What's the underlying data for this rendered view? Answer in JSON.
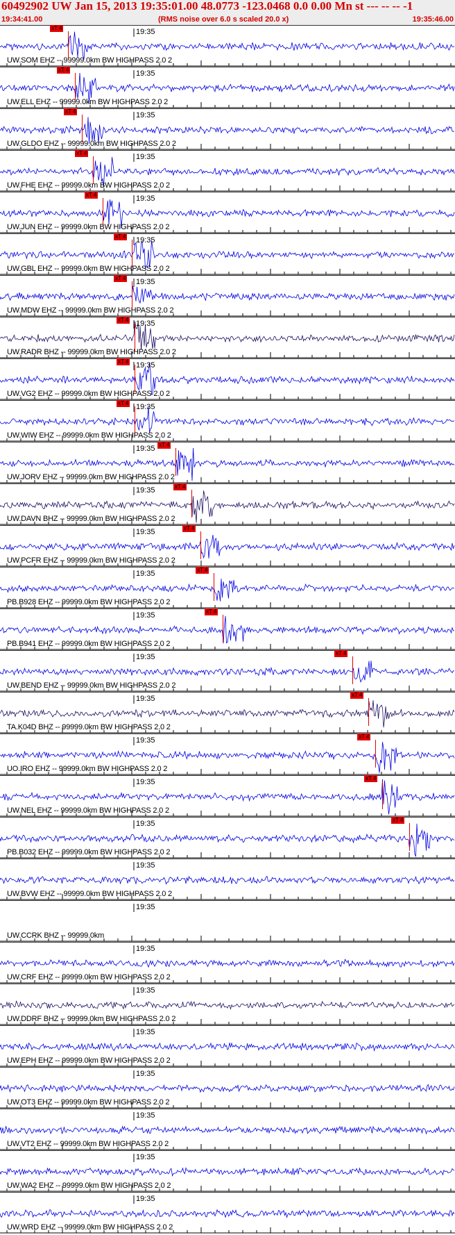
{
  "header": {
    "title": "60492902 UW Jan 15, 2013 19:35:01.00   48.0773 -123.0468  0.0 0.00 Mn st --- -- --   -1",
    "start_time": "19:34:41.00",
    "rms_note": "(RMS noise over 6.0 s scaled 20.0 x)",
    "end_time": "19:35:46.00"
  },
  "time_mark_label": "19:35",
  "pick_label": "xT 4",
  "colors": {
    "trace": "#0000e0",
    "trace_dark": "#1a1060",
    "pick": "#e00000",
    "title": "#d40000"
  },
  "traces": [
    {
      "label": "UW.SOM EHZ -- 99999.0km BW  HIGHPASS  2.0  2",
      "pick": 0.15
    },
    {
      "label": "UW.ELL EHZ -- 99999.0km BW  HIGHPASS  2.0  2",
      "pick": 0.165
    },
    {
      "label": "UW.GLDO EHZ -- 99999.0km BW  HIGHPASS  2.0  2",
      "pick": 0.18
    },
    {
      "label": "UW.FHE EHZ -- 99999.0km BW  HIGHPASS  2.0  2",
      "pick": 0.205
    },
    {
      "label": "UW.JUN EHZ -- 99999.0km BW  HIGHPASS  2.0  2",
      "pick": 0.225
    },
    {
      "label": "UW.GBL EHZ -- 99999.0km BW  HIGHPASS  2.0  2",
      "pick": 0.29,
      "dark": false
    },
    {
      "label": "UW.MDW EHZ -- 99999.0km BW  HIGHPASS  2.0  2",
      "pick": 0.29
    },
    {
      "label": "UW.RADR BHZ -- 99999.0km BW  HIGHPASS  2.0  2",
      "pick": 0.295,
      "dark": true
    },
    {
      "label": "UW.VG2 EHZ -- 99999.0km BW  HIGHPASS  2.0  2",
      "pick": 0.295
    },
    {
      "label": "UW.WIW EHZ -- 99999.0km BW  HIGHPASS  2.0  2",
      "pick": 0.295
    },
    {
      "label": "UW.JORV EHZ -- 99999.0km BW  HIGHPASS  2.0  2",
      "pick": 0.385
    },
    {
      "label": "UW.DAVN BHZ -- 99999.0km BW  HIGHPASS  2.0  2",
      "pick": 0.42,
      "dark": true
    },
    {
      "label": "UW.PCFR EHZ -- 99999.0km BW  HIGHPASS  2.0  2",
      "pick": 0.44
    },
    {
      "label": "PB.B928 EHZ -- 99999.0km BW  HIGHPASS  2.0  2",
      "pick": 0.47
    },
    {
      "label": "PB.B941 EHZ -- 99999.0km BW  HIGHPASS  2.0  2",
      "pick": 0.49
    },
    {
      "label": "UW.BEND EHZ -- 99999.0km BW  HIGHPASS  2.0  2",
      "pick": 0.775
    },
    {
      "label": "TA.K04D BHZ -- 99999.0km BW  HIGHPASS  2.0  2",
      "pick": 0.81,
      "dark": true
    },
    {
      "label": "UO.IRO EHZ -- 99999.0km BW  HIGHPASS  2.0  2",
      "pick": 0.825
    },
    {
      "label": "UW.NEL EHZ -- 99999.0km BW  HIGHPASS  2.0  2",
      "pick": 0.84
    },
    {
      "label": "PB.B032 EHZ -- 99999.0km BW  HIGHPASS  2.0  2",
      "pick": 0.9
    },
    {
      "label": "UW.BVW EHZ -- 99999.0km BW  HIGHPASS  2.0  2"
    },
    {
      "label": "UW.CCRK BHZ -- 99999.0km"
    },
    {
      "label": "UW.CRF EHZ -- 99999.0km BW  HIGHPASS  2.0  2"
    },
    {
      "label": "UW.DDRF BHZ -- 99999.0km BW  HIGHPASS  2.0  2",
      "dark": true
    },
    {
      "label": "UW.EPH EHZ -- 99999.0km BW  HIGHPASS  2.0  2"
    },
    {
      "label": "UW.OT3 EHZ -- 99999.0km BW  HIGHPASS  2.0  2"
    },
    {
      "label": "UW.VT2 EHZ -- 99999.0km BW  HIGHPASS  2.0  2"
    },
    {
      "label": "UW.WA2 EHZ -- 99999.0km BW  HIGHPASS  2.0  2"
    },
    {
      "label": "UW.WRD EHZ -- 99999.0km BW  HIGHPASS  2.0  2"
    }
  ]
}
